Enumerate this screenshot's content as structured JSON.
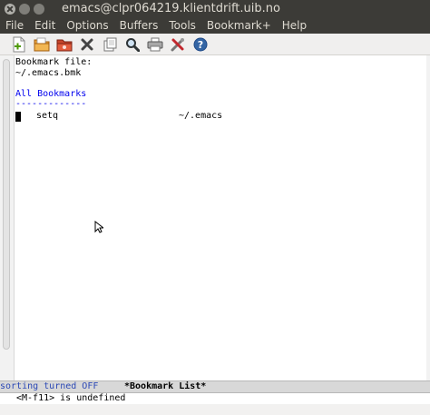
{
  "window": {
    "title": "emacs@clpr064219.klientdrift.uib.no"
  },
  "menubar": {
    "items": [
      "File",
      "Edit",
      "Options",
      "Buffers",
      "Tools",
      "Bookmark+",
      "Help"
    ]
  },
  "toolbar": {
    "icons": [
      "new-file-icon",
      "open-file-icon",
      "open-directory-icon",
      "close-buffer-icon",
      "save-icon",
      "search-icon",
      "print-icon",
      "preferences-icon",
      "help-icon"
    ]
  },
  "buffer": {
    "line1": "Bookmark file:",
    "line2": "~/.emacs.bmk",
    "heading": "All Bookmarks",
    "underline": "-------------",
    "bookmark_name": "setq",
    "bookmark_file": "~/.emacs"
  },
  "modeline": {
    "sort_status": "sorting turned OFF",
    "buffer_name": "*Bookmark List*"
  },
  "echo": {
    "message": "<M-f11> is undefined"
  }
}
